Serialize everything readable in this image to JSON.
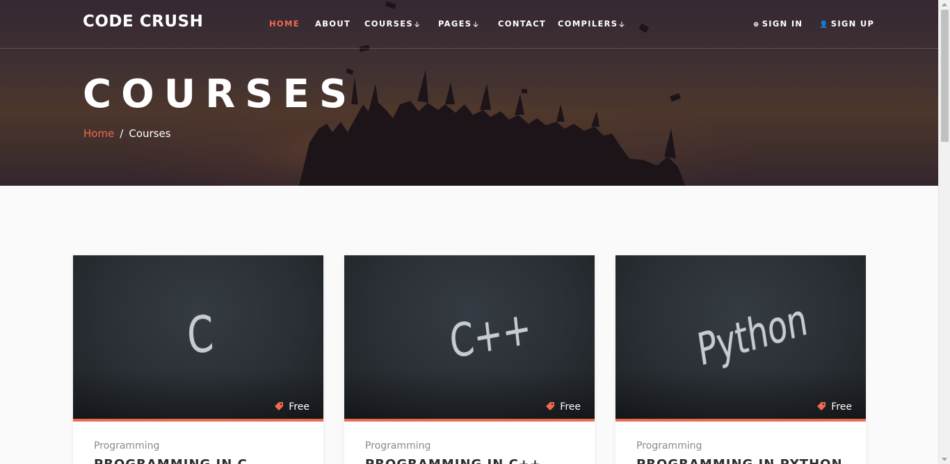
{
  "brand": "CODE CRUSH",
  "nav": {
    "items": [
      {
        "label": "HOME",
        "active": true
      },
      {
        "label": "ABOUT"
      },
      {
        "label": "COURSES",
        "dropdown": true
      },
      {
        "label": "PAGES",
        "dropdown": true
      },
      {
        "label": "CONTACT"
      },
      {
        "label": "COMPILERS",
        "dropdown": true
      }
    ],
    "sign_in": "SIGN IN",
    "sign_up": "SIGN UP"
  },
  "hero": {
    "title": "COURSES",
    "breadcrumb": {
      "home": "Home",
      "separator": "/",
      "current": "Courses"
    }
  },
  "courses": [
    {
      "chalk": "C",
      "price": "Free",
      "category": "Programming",
      "title": "PROGRAMMING IN C"
    },
    {
      "chalk": "C++",
      "price": "Free",
      "category": "Programming",
      "title": "PROGRAMMING IN C++"
    },
    {
      "chalk": "Python",
      "price": "Free",
      "category": "Programming",
      "title": "PROGRAMMING IN PYTHON"
    }
  ],
  "colors": {
    "accent": "#f16a4f",
    "card_bg": "#2a2f35"
  },
  "icons": {
    "sign_in": "sign-in-icon",
    "sign_up": "user-icon",
    "price": "tag-icon",
    "dropdown": "chevron-down-icon"
  }
}
